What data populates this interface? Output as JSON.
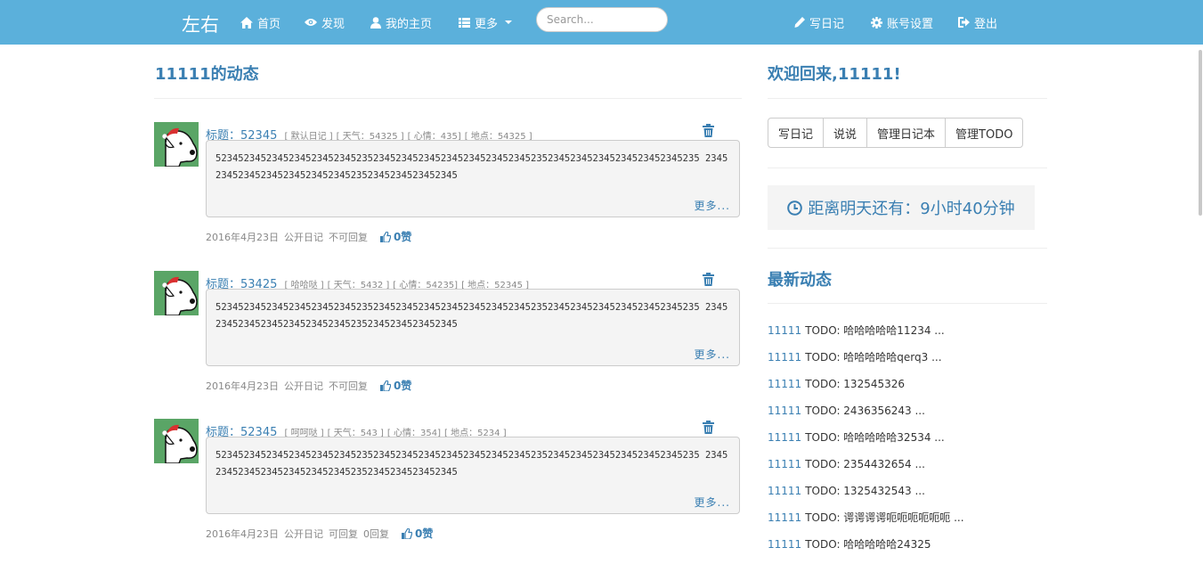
{
  "navbar": {
    "brand": "左右",
    "items": [
      {
        "label": "首页",
        "icon": "home-icon"
      },
      {
        "label": "发现",
        "icon": "eye-icon"
      },
      {
        "label": "我的主页",
        "icon": "user-icon"
      },
      {
        "label": "更多",
        "icon": "list-icon"
      }
    ],
    "search_placeholder": "Search...",
    "right_items": [
      {
        "label": "写日记",
        "icon": "pencil-icon"
      },
      {
        "label": "账号设置",
        "icon": "gear-icon"
      },
      {
        "label": "登出",
        "icon": "logout-icon"
      }
    ]
  },
  "main": {
    "heading": "11111的动态",
    "posts": [
      {
        "title": "标题：52345",
        "meta": [
          "[ 默认日记 ]",
          "[ 天气：54325 ]",
          "[ 心情：435]",
          "[ 地点：54325 ]"
        ],
        "content": "52345234523452345234523452352345234523452345234523452345235234523452345234523452345235 23452345234523452345234523452352345234523452345",
        "more": "更多...",
        "date": "2016年4月23日",
        "visibility": "公开日记",
        "reply": "不可回复",
        "likes": "0赞"
      },
      {
        "title": "标题：53425",
        "meta": [
          "[ 哈哈哒 ]",
          "[ 天气：5432 ]",
          "[ 心情：54235]",
          "[ 地点：52345 ]"
        ],
        "content": "52345234523452345234523452352345234523452345234523452345235234523452345234523452345235 23452345234523452345234523452352345234523452345",
        "more": "更多...",
        "date": "2016年4月23日",
        "visibility": "公开日记",
        "reply": "不可回复",
        "likes": "0赞"
      },
      {
        "title": "标题：52345",
        "meta": [
          "[ 呵呵哒 ]",
          "[ 天气：543 ]",
          "[ 心情：354]",
          "[ 地点：5234 ]"
        ],
        "content": "52345234523452345234523452352345234523452345234523452345235234523452345234523452345235 23452345234523452345234523452352345234523452345",
        "more": "更多...",
        "date": "2016年4月23日",
        "visibility": "公开日记",
        "reply": "可回复",
        "reply_count": "0回复",
        "likes": "0赞"
      }
    ]
  },
  "sidebar": {
    "welcome": "欢迎回来,11111!",
    "buttons": [
      "写日记",
      "说说",
      "管理日记本",
      "管理TODO"
    ],
    "countdown": "距离明天还有：9小时40分钟",
    "latest_heading": "最新动态",
    "feed": [
      {
        "user": "11111",
        "text": "TODO: 哈哈哈哈哈11234 ..."
      },
      {
        "user": "11111",
        "text": "TODO: 哈哈哈哈哈qerq3 ..."
      },
      {
        "user": "11111",
        "text": "TODO: 132545326"
      },
      {
        "user": "11111",
        "text": "TODO: 2436356243 ..."
      },
      {
        "user": "11111",
        "text": "TODO: 哈哈哈哈哈32534 ..."
      },
      {
        "user": "11111",
        "text": "TODO: 2354432654 ..."
      },
      {
        "user": "11111",
        "text": "TODO: 1325432543 ..."
      },
      {
        "user": "11111",
        "text": "TODO: 谔谔谔谔呃呃呃呃呃呃 ..."
      },
      {
        "user": "11111",
        "text": "TODO: 哈哈哈哈哈24325"
      }
    ]
  },
  "colors": {
    "navbar": "#5bb0db",
    "link": "#3a7fb2",
    "panel": "#f4f4f4"
  }
}
